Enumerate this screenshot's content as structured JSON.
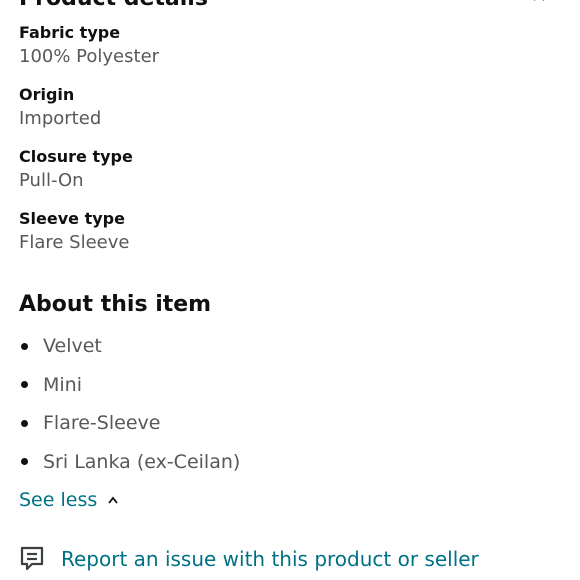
{
  "header": {
    "title": "Product details"
  },
  "details": [
    {
      "label": "Fabric type",
      "value": "100% Polyester"
    },
    {
      "label": "Origin",
      "value": "Imported"
    },
    {
      "label": "Closure type",
      "value": "Pull-On"
    },
    {
      "label": "Sleeve type",
      "value": "Flare Sleeve"
    }
  ],
  "about": {
    "title": "About this item",
    "bullets": [
      "Velvet",
      "Mini",
      "Flare-Sleeve",
      "Sri Lanka (ex-Ceilan)"
    ]
  },
  "see_less": {
    "label": "See less",
    "icon": "chevron-up-icon"
  },
  "report": {
    "label": "Report an issue with this product or seller",
    "icon": "feedback-icon"
  },
  "colors": {
    "text": "#0f1111",
    "muted": "#565959",
    "link": "#007185"
  }
}
